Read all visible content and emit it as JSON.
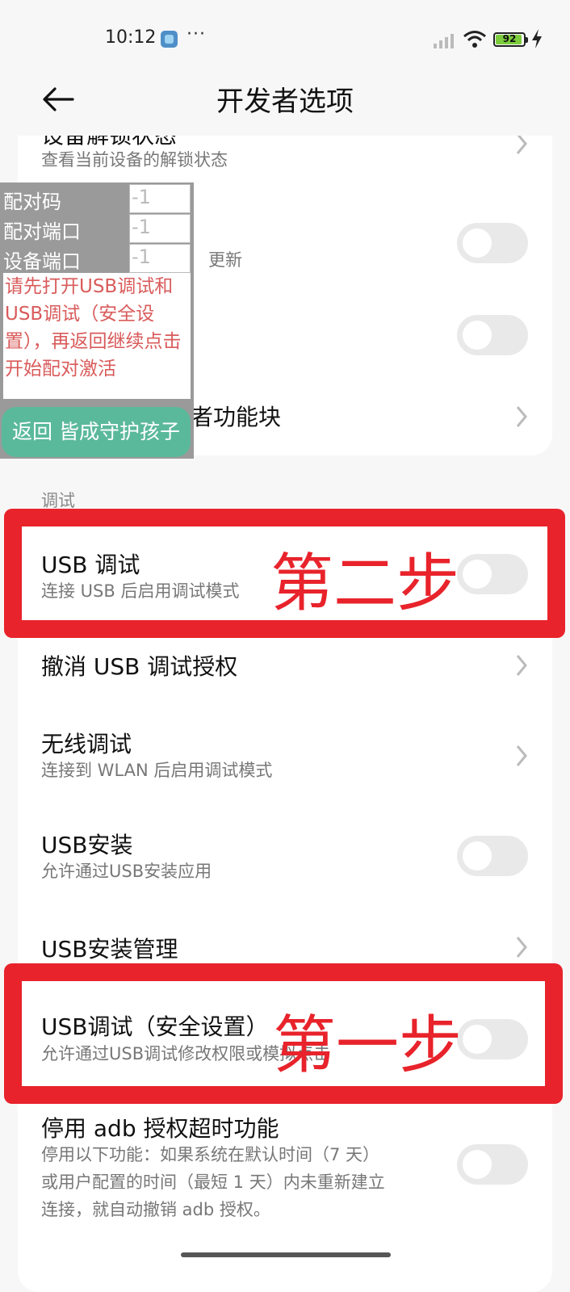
{
  "status_bar": {
    "time": "10:12",
    "dots": "···",
    "battery": "92"
  },
  "header": {
    "title": "开发者选项"
  },
  "card_top": {
    "unlock_title": "设备解锁状态",
    "unlock_sub": "查看当前设备的解锁状态",
    "hidden_sub_fragment": "更新",
    "quick_tiles_title_fragment": "者功能块"
  },
  "section_label": "调试",
  "card_debug": {
    "rows": [
      {
        "title": "USB 调试",
        "sub": "连接 USB 后启用调试模式"
      },
      {
        "title": "撤消 USB 调试授权"
      },
      {
        "title": "无线调试",
        "sub": "连接到 WLAN 后启用调试模式"
      },
      {
        "title": "USB安装",
        "sub": "允许通过USB安装应用"
      },
      {
        "title": "USB安装管理"
      },
      {
        "title": "USB调试（安全设置）",
        "sub": "允许通过USB调试修改权限或模拟点击"
      },
      {
        "title": "停用 adb 授权超时功能",
        "sub1": "停用以下功能：如果系统在默认时间（7 天）",
        "sub2": "或用户配置的时间（最短 1 天）内未重新建立",
        "sub3": "连接，就自动撤销 adb 授权。"
      }
    ]
  },
  "annotations": {
    "step2": "第二步",
    "step1": "第一步"
  },
  "overlay": {
    "pair_code_label": "配对码",
    "pair_code_value": "-1",
    "pair_port_label": "配对端口",
    "pair_port_value": "-1",
    "device_port_label": "设备端口",
    "device_port_value": "-1",
    "message": "请先打开USB调试和USB调试（安全设置），再返回继续点击开始配对激活",
    "button": "返回 皆成守护孩子"
  },
  "colors": {
    "accent_red": "#e8232b",
    "button_green": "#5bb99b",
    "message_red": "#d95b5b"
  }
}
